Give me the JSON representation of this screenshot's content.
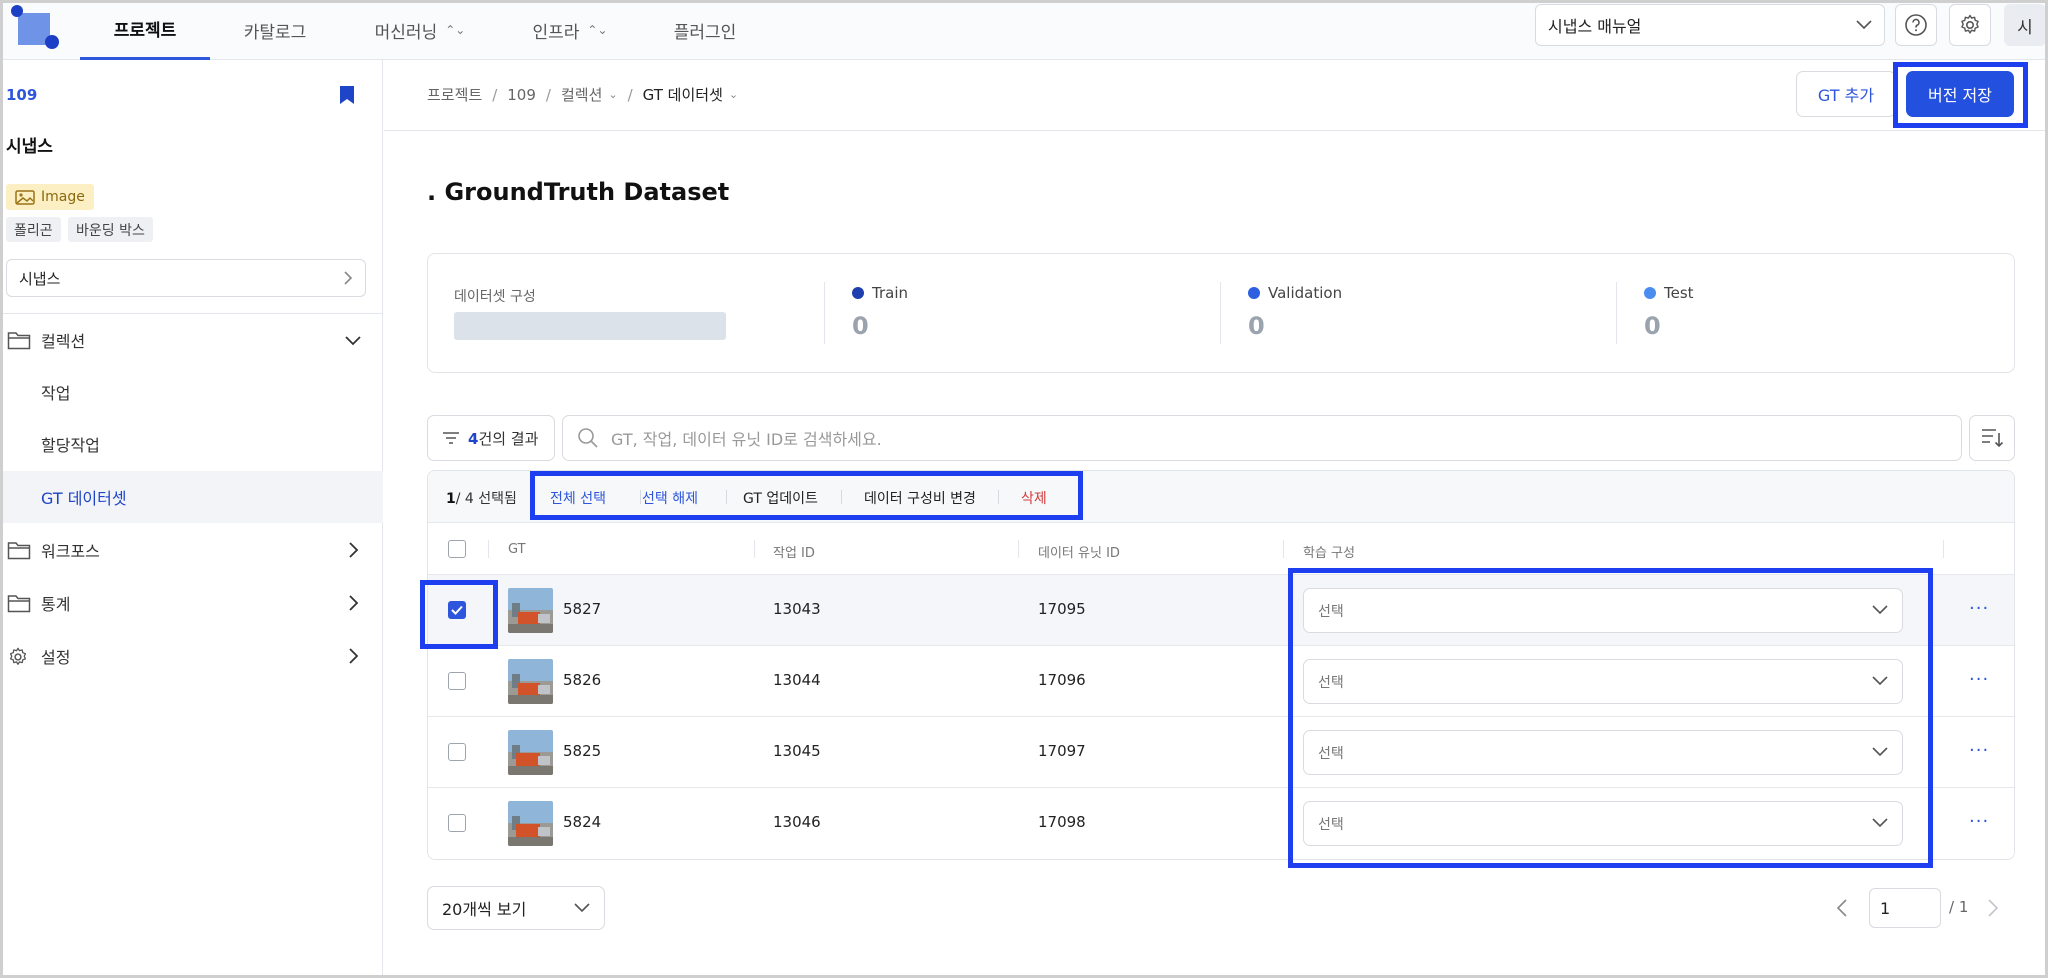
{
  "nav": {
    "tabs": [
      {
        "label": "프로젝트",
        "has_menu": false,
        "active": true
      },
      {
        "label": "카탈로그",
        "has_menu": false,
        "active": false
      },
      {
        "label": "머신러닝",
        "has_menu": true,
        "active": false
      },
      {
        "label": "인프라",
        "has_menu": true,
        "active": false
      },
      {
        "label": "플러그인",
        "has_menu": false,
        "active": false
      }
    ],
    "manual_select": "시냅스 매뉴얼",
    "avatar": "시",
    "help_icon": "help-circle-icon",
    "settings_icon": "gear-icon"
  },
  "sidebar": {
    "project_number": "109",
    "project_name": "시냅스",
    "data_type": "Image",
    "annotation_types": [
      "폴리곤",
      "바운딩 박스"
    ],
    "project_select": "시냅스",
    "items": [
      {
        "label": "컬렉션",
        "icon": "folder-icon",
        "expanded": true
      },
      {
        "label": "워크포스",
        "icon": "folder-icon",
        "expanded": false
      },
      {
        "label": "통계",
        "icon": "folder-icon",
        "expanded": false
      },
      {
        "label": "설정",
        "icon": "gear-icon",
        "expanded": false
      }
    ],
    "collection_subitems": [
      {
        "label": "작업",
        "active": false
      },
      {
        "label": "할당작업",
        "active": false
      },
      {
        "label": "GT 데이터셋",
        "active": true
      }
    ]
  },
  "header": {
    "breadcrumb": [
      "프로젝트",
      "109",
      "컬렉션",
      "GT 데이터셋"
    ],
    "add_gt_label": "GT 추가",
    "save_version_label": "버전 저장"
  },
  "main": {
    "title": ". GroundTruth Dataset",
    "composition_label": "데이터셋 구성",
    "stats": [
      {
        "name": "Train",
        "value": "0",
        "color": "#1f3fae"
      },
      {
        "name": "Validation",
        "value": "0",
        "color": "#2d5fe0"
      },
      {
        "name": "Test",
        "value": "0",
        "color": "#4a8cf0"
      }
    ],
    "result_count": "4",
    "result_suffix": "건의 결과",
    "search_placeholder": "GT, 작업, 데이터 유닛 ID로 검색하세요."
  },
  "table": {
    "selected": "1",
    "total": "/ 4",
    "selected_suffix": " 선택됨",
    "actions": {
      "select_all": "전체 선택",
      "deselect": "선택 해제",
      "gt_update": "GT 업데이트",
      "ratio_change": "데이터 구성비 변경",
      "delete": "삭제"
    },
    "columns": [
      "GT",
      "작업 ID",
      "데이터 유닛 ID",
      "학습 구성"
    ],
    "rows": [
      {
        "gt": "5827",
        "task_id": "13043",
        "data_unit_id": "17095",
        "split": "선택",
        "checked": true
      },
      {
        "gt": "5826",
        "task_id": "13044",
        "data_unit_id": "17096",
        "split": "선택",
        "checked": false
      },
      {
        "gt": "5825",
        "task_id": "13045",
        "data_unit_id": "17097",
        "split": "선택",
        "checked": false
      },
      {
        "gt": "5824",
        "task_id": "13046",
        "data_unit_id": "17098",
        "split": "선택",
        "checked": false
      }
    ]
  },
  "pagination": {
    "page_size": "20개씩 보기",
    "current_page": "1",
    "total_pages": "/ 1"
  },
  "colors": {
    "accent": "#2d56dd",
    "highlight": "#1d3ff0",
    "danger": "#d23b3b"
  }
}
